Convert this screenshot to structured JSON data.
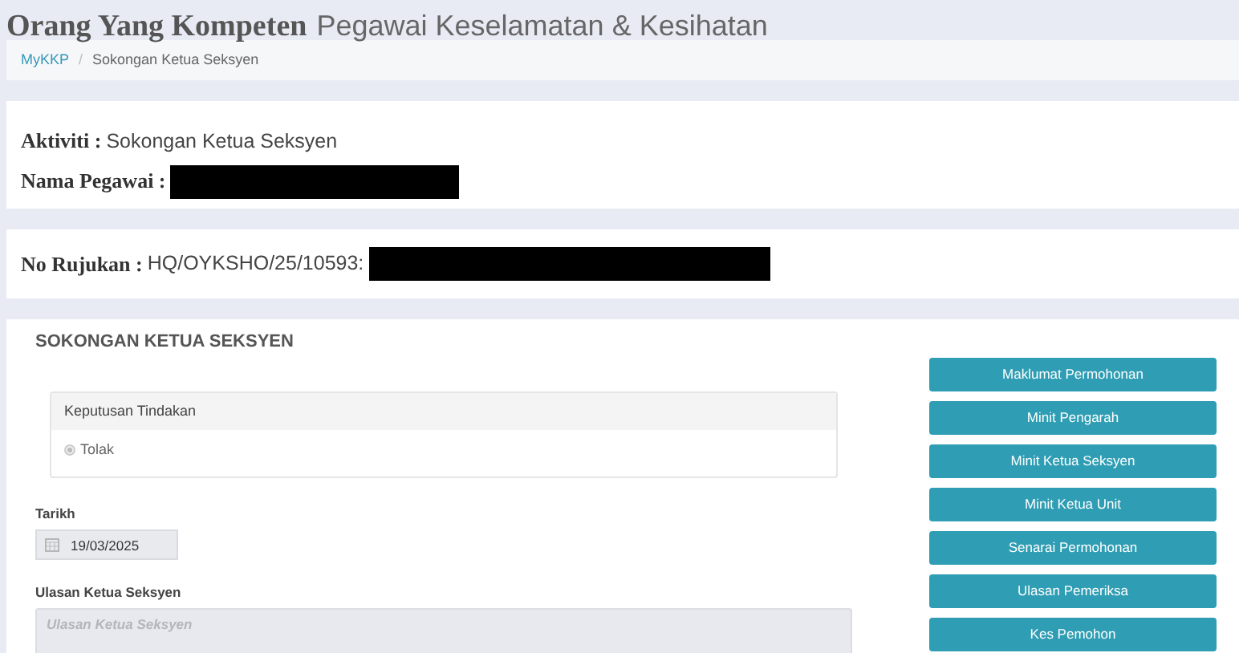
{
  "header": {
    "title_strong": "Orang Yang Kompeten",
    "title": "Pegawai Keselamatan & Kesihatan"
  },
  "breadcrumb_separator": "/",
  "breadcrumb": [
    {
      "label": "MyKKP",
      "kind": "link"
    },
    {
      "label": "Sokongan Ketua Seksyen",
      "kind": "current"
    }
  ],
  "info": [
    {
      "label": "Aktiviti :",
      "value": "Sokongan Ketua Seksyen",
      "redacted": false
    },
    {
      "label": "Nama Pegawai :",
      "redacted": true
    }
  ],
  "reference": {
    "label": "No Rujukan :",
    "value": "HQ/OYKSHO/25/10593:",
    "redacted": true
  },
  "form": {
    "title": "SOKONGAN KETUA SEKSYEN",
    "decision": {
      "title": "Keputusan Tindakan",
      "options": [
        {
          "label": "Tolak",
          "selected": true,
          "disabled": true
        }
      ]
    },
    "date": {
      "label": "Tarikh",
      "value": "19/03/2025"
    },
    "remarks": {
      "label": "Ulasan Ketua Seksyen",
      "placeholder": "Ulasan Ketua Seksyen"
    }
  },
  "actions": [
    "Maklumat Permohonan",
    "Minit Pengarah",
    "Minit Ketua Seksyen",
    "Minit Ketua Unit",
    "Senarai Permohonan",
    "Ulasan Pemeriksa",
    "Kes Pemohon"
  ]
}
